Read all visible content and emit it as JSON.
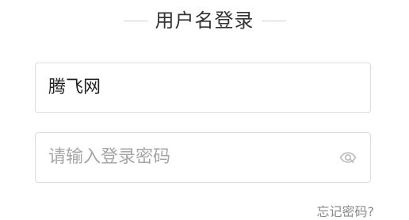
{
  "login": {
    "title": "用户名登录",
    "username": {
      "value": "腾飞网"
    },
    "password": {
      "placeholder": "请输入登录密码",
      "toggle_icon": "eye-hidden-icon"
    },
    "forgot_password": "忘记密码?"
  },
  "colors": {
    "border": "#dcdcdc",
    "text": "#333333",
    "placeholder": "#a6a6a6",
    "muted": "#8a8a8a"
  }
}
